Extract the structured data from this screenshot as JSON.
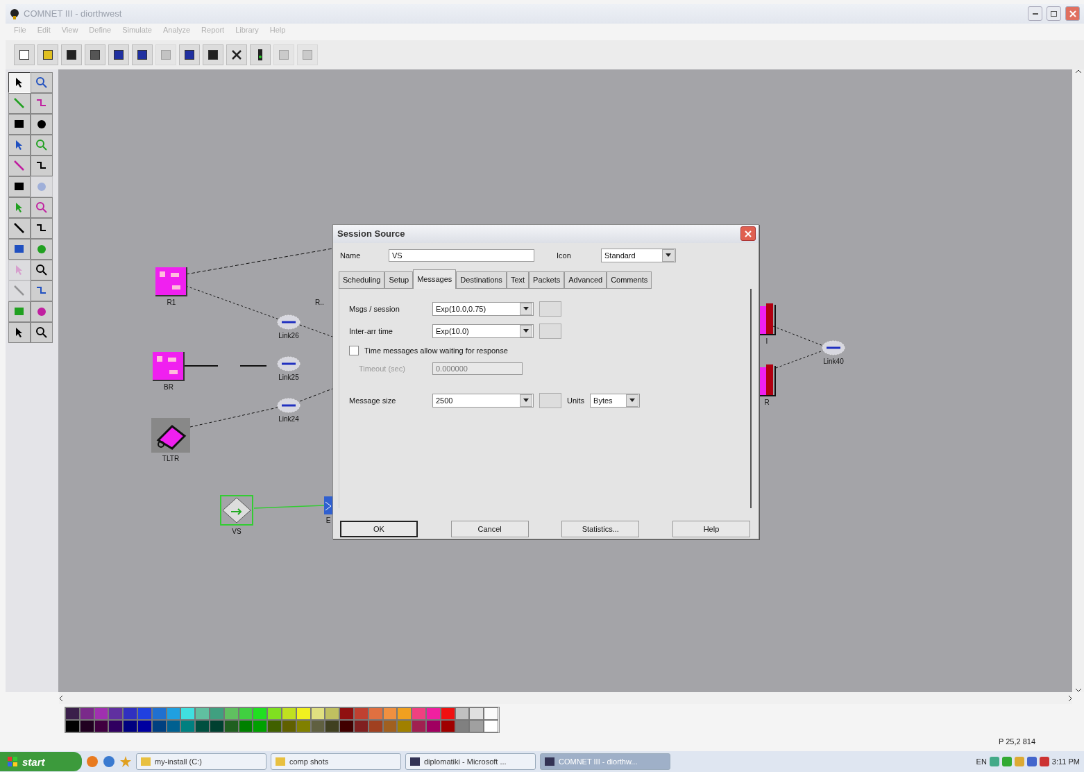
{
  "window": {
    "title": "COMNET III - diorthwest"
  },
  "menu": [
    "File",
    "Edit",
    "View",
    "Define",
    "Simulate",
    "Analyze",
    "Report",
    "Library",
    "Help"
  ],
  "toolbar": [
    {
      "disabled": false
    },
    {
      "disabled": false
    },
    {
      "disabled": false
    },
    {
      "disabled": false
    },
    {
      "disabled": false
    },
    {
      "disabled": false
    },
    {
      "disabled": true
    },
    {
      "disabled": false
    },
    {
      "disabled": false
    },
    {
      "disabled": false
    },
    {
      "disabled": false
    },
    {
      "disabled": true
    },
    {
      "disabled": true
    }
  ],
  "tools": [
    {
      "selected": true,
      "disabled": false
    },
    {
      "selected": false,
      "disabled": false
    },
    {
      "selected": false,
      "disabled": false
    },
    {
      "selected": false,
      "disabled": false
    },
    {
      "selected": false,
      "disabled": false
    },
    {
      "selected": false,
      "disabled": false
    },
    {
      "selected": false,
      "disabled": false
    },
    {
      "selected": false,
      "disabled": false
    },
    {
      "selected": false,
      "disabled": false
    },
    {
      "selected": false,
      "disabled": false
    },
    {
      "selected": false,
      "disabled": false
    },
    {
      "selected": false,
      "disabled": true
    },
    {
      "selected": false,
      "disabled": false
    },
    {
      "selected": false,
      "disabled": false
    },
    {
      "selected": false,
      "disabled": false
    },
    {
      "selected": false,
      "disabled": false
    },
    {
      "selected": false,
      "disabled": false
    },
    {
      "selected": false,
      "disabled": false
    },
    {
      "selected": false,
      "disabled": true
    },
    {
      "selected": false,
      "disabled": false
    },
    {
      "selected": false,
      "disabled": true
    },
    {
      "selected": false,
      "disabled": false
    },
    {
      "selected": false,
      "disabled": false
    },
    {
      "selected": false,
      "disabled": false
    },
    {
      "selected": false,
      "disabled": false
    },
    {
      "selected": false,
      "disabled": false
    }
  ],
  "canvas": {
    "nodes": [
      {
        "kind": "router",
        "label": "R1"
      },
      {
        "kind": "router",
        "label": "BR"
      },
      {
        "kind": "phone",
        "label": "TLTR"
      },
      {
        "kind": "source",
        "label": "VS"
      },
      {
        "kind": "link",
        "label": "Link26"
      },
      {
        "kind": "link",
        "label": "Link25"
      },
      {
        "kind": "link",
        "label": "Link24"
      },
      {
        "kind": "link",
        "label": "Link40"
      },
      {
        "kind": "box",
        "label": "I"
      },
      {
        "kind": "box",
        "label": "R"
      },
      {
        "kind": "text",
        "label": "R.."
      },
      {
        "kind": "stub",
        "label": "E"
      }
    ]
  },
  "dialog": {
    "title": "Session Source",
    "name_label": "Name",
    "name_value": "VS",
    "icon_label": "Icon",
    "icon_value": "Standard",
    "tabs": [
      {
        "label": "Scheduling",
        "selected": false
      },
      {
        "label": "Setup",
        "selected": false
      },
      {
        "label": "Messages",
        "selected": true
      },
      {
        "label": "Destinations",
        "selected": false
      },
      {
        "label": "Text",
        "selected": false
      },
      {
        "label": "Packets",
        "selected": false
      },
      {
        "label": "Advanced",
        "selected": false
      },
      {
        "label": "Comments",
        "selected": false
      }
    ],
    "fields": [
      {
        "label": "Msgs / session",
        "value": "Exp(10.0,0.75)"
      },
      {
        "label": "Inter-arr time",
        "value": "Exp(10.0)"
      }
    ],
    "checkbox": {
      "label": "Time messages allow waiting for response",
      "checked": false
    },
    "timeout": {
      "label": "Timeout (sec)",
      "value": "0.000000",
      "disabled": true
    },
    "size": {
      "label": "Message size",
      "value": "2500",
      "units_label": "Units",
      "units_value": "Bytes"
    },
    "buttons": [
      "OK",
      "Cancel",
      "Statistics...",
      "Help"
    ]
  },
  "palette": [
    {
      "color": "#3a1f4a"
    },
    {
      "color": "#7a2a8a"
    },
    {
      "color": "#a030b0"
    },
    {
      "color": "#6030a0"
    },
    {
      "color": "#3030c0"
    },
    {
      "color": "#2040e0"
    },
    {
      "color": "#2070d0"
    },
    {
      "color": "#20a0e0"
    },
    {
      "color": "#40e0e0"
    },
    {
      "color": "#60c0a0"
    },
    {
      "color": "#40a080"
    },
    {
      "color": "#60c060"
    },
    {
      "color": "#40d040"
    },
    {
      "color": "#20e020"
    },
    {
      "color": "#80e020"
    },
    {
      "color": "#c0e020"
    },
    {
      "color": "#f0f020"
    },
    {
      "color": "#e0e080"
    },
    {
      "color": "#c0c060"
    },
    {
      "color": "#901010"
    },
    {
      "color": "#c04030"
    },
    {
      "color": "#e07040"
    },
    {
      "color": "#f09040"
    },
    {
      "color": "#f0a020"
    },
    {
      "color": "#f04080"
    },
    {
      "color": "#f020a0"
    },
    {
      "color": "#f01010"
    },
    {
      "color": "#c0c0c0"
    },
    {
      "color": "#e0e0e0"
    },
    {
      "color": "#fafafa"
    },
    {
      "color": "#000000"
    },
    {
      "color": "#200020"
    },
    {
      "color": "#400040"
    },
    {
      "color": "#300060"
    },
    {
      "color": "#000080"
    },
    {
      "color": "#0000a0"
    },
    {
      "color": "#004080"
    },
    {
      "color": "#006090"
    },
    {
      "color": "#008080"
    },
    {
      "color": "#005040"
    },
    {
      "color": "#004030"
    },
    {
      "color": "#206020"
    },
    {
      "color": "#008000"
    },
    {
      "color": "#00a000"
    },
    {
      "color": "#406000"
    },
    {
      "color": "#606000"
    },
    {
      "color": "#808000"
    },
    {
      "color": "#606040"
    },
    {
      "color": "#404020"
    },
    {
      "color": "#400000"
    },
    {
      "color": "#802020"
    },
    {
      "color": "#a04020"
    },
    {
      "color": "#a06020"
    },
    {
      "color": "#a08000"
    },
    {
      "color": "#a02050"
    },
    {
      "color": "#a00060"
    },
    {
      "color": "#a00000"
    },
    {
      "color": "#808080"
    },
    {
      "color": "#a0a0a0"
    },
    {
      "color": "#ffffff"
    }
  ],
  "status": "P 25,2 814",
  "taskbar": {
    "start": "start",
    "tasks": [
      {
        "label": "my-install (C:)",
        "selected": false
      },
      {
        "label": "comp shots",
        "selected": false
      },
      {
        "label": "diplomatiki - Microsoft ...",
        "selected": false
      },
      {
        "label": "COMNET III - diorthw...",
        "selected": true
      }
    ],
    "lang": "EN",
    "clock": "3:11 PM"
  }
}
